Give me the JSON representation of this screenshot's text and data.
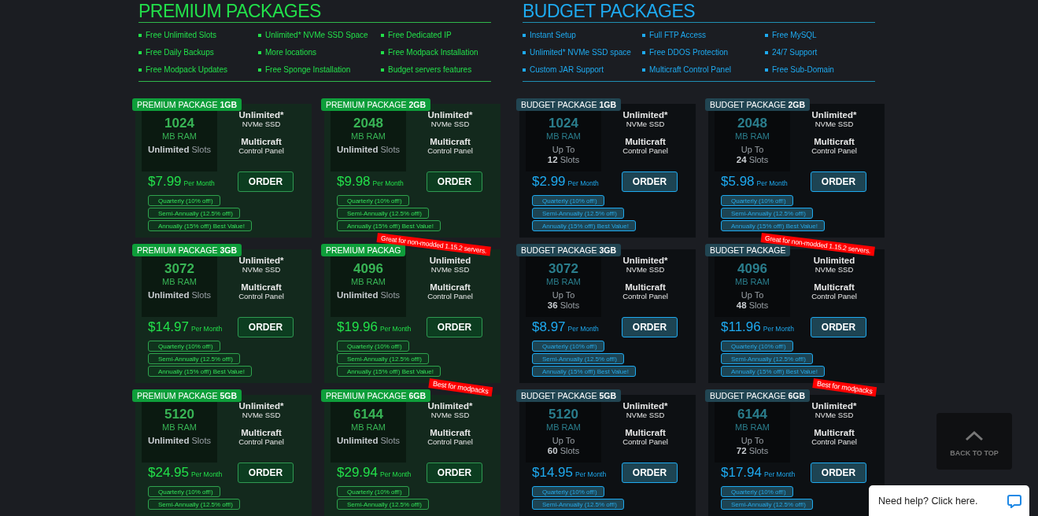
{
  "sections": [
    {
      "kind": "premium",
      "title": "PREMIUM PACKAGES",
      "features": [
        "Free Unlimited Slots",
        "Unlimited* NVMe SSD Space",
        "Free Dedicated IP",
        "Free Daily Backups",
        "More locations",
        "Free Modpack Installation",
        "Free Modpack Updates",
        "Free Sponge Installation",
        "Budget servers features"
      ],
      "packages": [
        {
          "tag": "PREMIUM PACKAGE **1GB**",
          "ram": "1024",
          "ram_unit": "MB RAM",
          "slots_value": "Unlimited",
          "slots_label": "Slots",
          "storage_title": "Unlimited*",
          "storage_sub": "NVMe SSD",
          "panel_title": "Multicraft",
          "panel_sub": "Control Panel",
          "price": "$7.99",
          "per": "Per Month",
          "order": "ORDER",
          "options": [
            "Quarterly (10% off!)",
            "Semi-Annually (12.5% off!)",
            "Annually (15% off!) Best Value!"
          ]
        },
        {
          "tag": "PREMIUM PACKAGE **2GB**",
          "ram": "2048",
          "ram_unit": "MB RAM",
          "slots_value": "Unlimited",
          "slots_label": "Slots",
          "storage_title": "Unlimited*",
          "storage_sub": "NVMe SSD",
          "panel_title": "Multicraft",
          "panel_sub": "Control Panel",
          "price": "$9.98",
          "per": "Per Month",
          "order": "ORDER",
          "options": [
            "Quarterly (10% off!)",
            "Semi-Annually (12.5% off!)",
            "Annually (15% off!) Best Value!"
          ]
        },
        {
          "tag": "PREMIUM PACKAGE **3GB**",
          "ram": "3072",
          "ram_unit": "MB RAM",
          "slots_value": "Unlimited",
          "slots_label": "Slots",
          "storage_title": "Unlimited*",
          "storage_sub": "NVMe SSD",
          "panel_title": "Multicraft",
          "panel_sub": "Control Panel",
          "price": "$14.97",
          "per": "Per Month",
          "order": "ORDER",
          "options": [
            "Quarterly (10% off!)",
            "Semi-Annually (12.5% off!)",
            "Annually (15% off!) Best Value!"
          ]
        },
        {
          "tag": "PREMIUM PACKAG",
          "ribbon": "Great for non-modded 1.15.2 servers.",
          "ram": "4096",
          "ram_unit": "MB RAM",
          "slots_value": "Unlimited",
          "slots_label": "Slots",
          "storage_title": "Unlimited",
          "storage_sub": "NVMe SSD",
          "panel_title": "Multicraft",
          "panel_sub": "Control Panel",
          "price": "$19.96",
          "per": "Per Month",
          "order": "ORDER",
          "options": [
            "Quarterly (10% off!)",
            "Semi-Annually (12.5% off!)",
            "Annually (15% off!) Best Value!"
          ]
        },
        {
          "tag": "PREMIUM PACKAGE **5GB**",
          "ram": "5120",
          "ram_unit": "MB RAM",
          "slots_value": "Unlimited",
          "slots_label": "Slots",
          "storage_title": "Unlimited*",
          "storage_sub": "NVMe SSD",
          "panel_title": "Multicraft",
          "panel_sub": "Control Panel",
          "price": "$24.95",
          "per": "Per Month",
          "order": "ORDER",
          "options": [
            "Quarterly (10% off!)",
            "Semi-Annually (12.5% off!)"
          ]
        },
        {
          "tag": "PREMIUM PACKAGE **6GB**",
          "ribbon": "Best for modpacks",
          "ram": "6144",
          "ram_unit": "MB RAM",
          "slots_value": "Unlimited",
          "slots_label": "Slots",
          "storage_title": "Unlimited*",
          "storage_sub": "NVMe SSD",
          "panel_title": "Multicraft",
          "panel_sub": "Control Panel",
          "price": "$29.94",
          "per": "Per Month",
          "order": "ORDER",
          "options": [
            "Quarterly (10% off!)",
            "Semi-Annually (12.5% off!)"
          ]
        }
      ]
    },
    {
      "kind": "budget",
      "title": "BUDGET PACKAGES",
      "features": [
        "Instant Setup",
        "Full FTP Access",
        "Free MySQL",
        "Unlimited* NVMe SSD space",
        "Free DDOS Protection",
        "24/7 Support",
        "Custom JAR Support",
        "Multicraft Control Panel",
        "Free Sub-Domain"
      ],
      "packages": [
        {
          "tag": "BUDGET PACKAGE **1GB**",
          "ram": "1024",
          "ram_unit": "MB RAM",
          "slots_prefix": "Up To",
          "slots_value": "12",
          "slots_label": "Slots",
          "storage_title": "Unlimited*",
          "storage_sub": "NVMe SSD",
          "panel_title": "Multicraft",
          "panel_sub": "Control Panel",
          "price": "$2.99",
          "per": "Per Month",
          "order": "ORDER",
          "options": [
            "Quarterly (10% off!)",
            "Semi-Annually (12.5% off!)",
            "Annually (15% off!) Best Value!"
          ]
        },
        {
          "tag": "BUDGET PACKAGE **2GB**",
          "ram": "2048",
          "ram_unit": "MB RAM",
          "slots_prefix": "Up To",
          "slots_value": "24",
          "slots_label": "Slots",
          "storage_title": "Unlimited*",
          "storage_sub": "NVMe SSD",
          "panel_title": "Multicraft",
          "panel_sub": "Control Panel",
          "price": "$5.98",
          "per": "Per Month",
          "order": "ORDER",
          "options": [
            "Quarterly (10% off!)",
            "Semi-Annually (12.5% off!)",
            "Annually (15% off!) Best Value!"
          ]
        },
        {
          "tag": "BUDGET PACKAGE **3GB**",
          "ram": "3072",
          "ram_unit": "MB RAM",
          "slots_prefix": "Up To",
          "slots_value": "36",
          "slots_label": "Slots",
          "storage_title": "Unlimited*",
          "storage_sub": "NVMe SSD",
          "panel_title": "Multicraft",
          "panel_sub": "Control Panel",
          "price": "$8.97",
          "per": "Per Month",
          "order": "ORDER",
          "options": [
            "Quarterly (10% off!)",
            "Semi-Annually (12.5% off!)",
            "Annually (15% off!) Best Value!"
          ]
        },
        {
          "tag": "BUDGET PACKAGE",
          "ribbon": "Great for non-modded 1.15.2 servers.",
          "ram": "4096",
          "ram_unit": "MB RAM",
          "slots_prefix": "Up To",
          "slots_value": "48",
          "slots_label": "Slots",
          "storage_title": "Unlimited",
          "storage_sub": "NVMe SSD",
          "panel_title": "Multicraft",
          "panel_sub": "Control Panel",
          "price": "$11.96",
          "per": "Per Month",
          "order": "ORDER",
          "options": [
            "Quarterly (10% off!)",
            "Semi-Annually (12.5% off!)",
            "Annually (15% off!) Best Value!"
          ]
        },
        {
          "tag": "BUDGET PACKAGE **5GB**",
          "ram": "5120",
          "ram_unit": "MB RAM",
          "slots_prefix": "Up To",
          "slots_value": "60",
          "slots_label": "Slots",
          "storage_title": "Unlimited*",
          "storage_sub": "NVMe SSD",
          "panel_title": "Multicraft",
          "panel_sub": "Control Panel",
          "price": "$14.95",
          "per": "Per Month",
          "order": "ORDER",
          "options": [
            "Quarterly (10% off!)",
            "Semi-Annually (12.5% off!)"
          ]
        },
        {
          "tag": "BUDGET PACKAGE **6GB**",
          "ribbon": "Best for modpacks",
          "ram": "6144",
          "ram_unit": "MB RAM",
          "slots_prefix": "Up To",
          "slots_value": "72",
          "slots_label": "Slots",
          "storage_title": "Unlimited*",
          "storage_sub": "NVMe SSD",
          "panel_title": "Multicraft",
          "panel_sub": "Control Panel",
          "price": "$17.94",
          "per": "Per Month",
          "order": "ORDER",
          "options": [
            "Quarterly (10% off!)",
            "Semi-Annually (12.5% off!)"
          ]
        }
      ]
    }
  ],
  "back_to_top": "BACK TO TOP",
  "help_widget": {
    "text": "Need help? Click here."
  }
}
